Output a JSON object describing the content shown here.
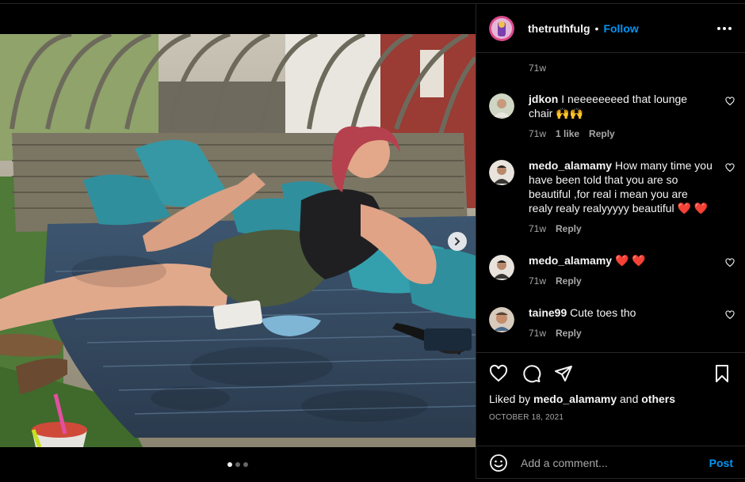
{
  "post": {
    "username": "thetruthfulg",
    "separator": "•",
    "follow_label": "Follow",
    "more_icon": "more-horizontal-icon"
  },
  "caption_meta": {
    "time": "71w"
  },
  "comments": [
    {
      "user": "jdkon",
      "text": "I neeeeeeeed that lounge chair 🙌🙌",
      "time": "71w",
      "likes": "1 like",
      "reply": "Reply"
    },
    {
      "user": "medo_alamamy",
      "text": "How many time you have been told that you are so beautiful ,for real i mean you are realy realy realyyyyy beautiful ❤️ ❤️",
      "time": "71w",
      "reply": "Reply"
    },
    {
      "user": "medo_alamamy",
      "text": "❤️ ❤️",
      "time": "71w",
      "reply": "Reply"
    },
    {
      "user": "taine99",
      "text": "Cute toes tho",
      "time": "71w",
      "reply": "Reply"
    }
  ],
  "actions": {
    "liked_prefix": "Liked by",
    "liked_user": "medo_alamamy",
    "liked_and": "and",
    "liked_others": "others",
    "date": "OCTOBER 18, 2021"
  },
  "composer": {
    "placeholder": "Add a comment...",
    "post_label": "Post"
  },
  "carousel": {
    "slides": 3,
    "active": 1
  },
  "colors": {
    "accent": "#0095f6",
    "background": "#000000",
    "muted": "#a8a8a8"
  }
}
